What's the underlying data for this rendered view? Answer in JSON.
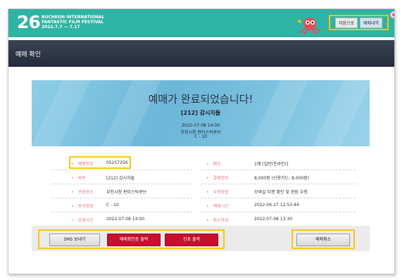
{
  "header": {
    "festival_number": "26",
    "festival_name_lines": [
      "BUCHEON INTERNATIONAL",
      "FANTASTIC FILM FESTIVAL",
      "2022.7.7 — 7.17"
    ],
    "buttons": [
      {
        "label": "처음으로"
      },
      {
        "label": "예매내역"
      }
    ]
  },
  "page_title": "예매 확인",
  "banner": {
    "heading": "예매가 완료되었습니다!",
    "movie": "[212] 감시자들",
    "datetime": "2022-07-08 14:00",
    "venue": "부천시청 판타스틱큐브",
    "seat": "C - 10"
  },
  "details": {
    "left": [
      {
        "label": "예매번호",
        "value": "05257256"
      },
      {
        "label": "제목",
        "value": "[212] 감시자들"
      },
      {
        "label": "관람장소",
        "value": "부천시청 판타스틱큐브"
      },
      {
        "label": "좌석정보",
        "value": "C - 10"
      },
      {
        "label": "상영시간",
        "value": "2022-07-08 14:00"
      }
    ],
    "right": [
      {
        "label": "매수",
        "value": "1매 [일반(온라인)]"
      },
      {
        "label": "결제정보",
        "value": "8,000원 (신용카드: 8,000원)"
      },
      {
        "label": "수령방법",
        "value": "모바일 티켓 확인 및 현장 수령"
      },
      {
        "label": "예매시간",
        "value": "2022-06-27 12:53:44"
      },
      {
        "label": "취소마감",
        "value": "2022-07-08 13:30"
      }
    ]
  },
  "actions": {
    "sms_label": "SMS 보내기",
    "print_confirm_label": "예매확인증 출력",
    "print_ticket_label": "진표 출력",
    "cancel_label": "예매취소"
  },
  "colors": {
    "festival_teal": "#2fb3a4",
    "highlight_yellow": "#f5c518",
    "label_pink": "#e07a86",
    "button_red": "#c8102e",
    "banner_blue": "#7fc3e0",
    "titlebar_dark": "#2b3140"
  }
}
